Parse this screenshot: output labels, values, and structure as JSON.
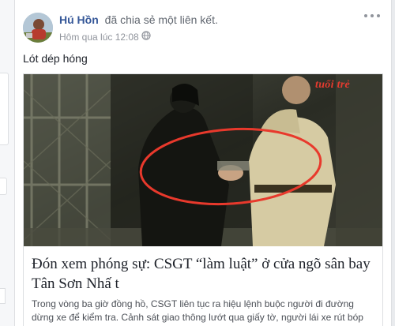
{
  "post": {
    "author": "Hú Hồn",
    "action": "đã chia sẻ một liên kết.",
    "timestamp": "Hôm qua lúc 12:08",
    "text": "Lót dép hóng",
    "icons": {
      "more": "more-dots-icon",
      "audience": "globe-icon"
    }
  },
  "link": {
    "brand": "tuổi trẻ",
    "title": "Đón xem phóng sự: CSGT “làm luật” ở cửa ngõ sân bay Tân Sơn Nhấ t",
    "description": "Trong vòng ba giờ đồng hồ, CSGT liên tục ra hiệu lệnh buộc người đi đường dừng xe để kiểm tra. Cảnh sát giao thông lướt qua giấy tờ, người lái xe rút bóp đưa tiền…."
  },
  "colors": {
    "name": "#365899",
    "annotation_circle": "#e8392c",
    "brand": "#e53b2f"
  }
}
